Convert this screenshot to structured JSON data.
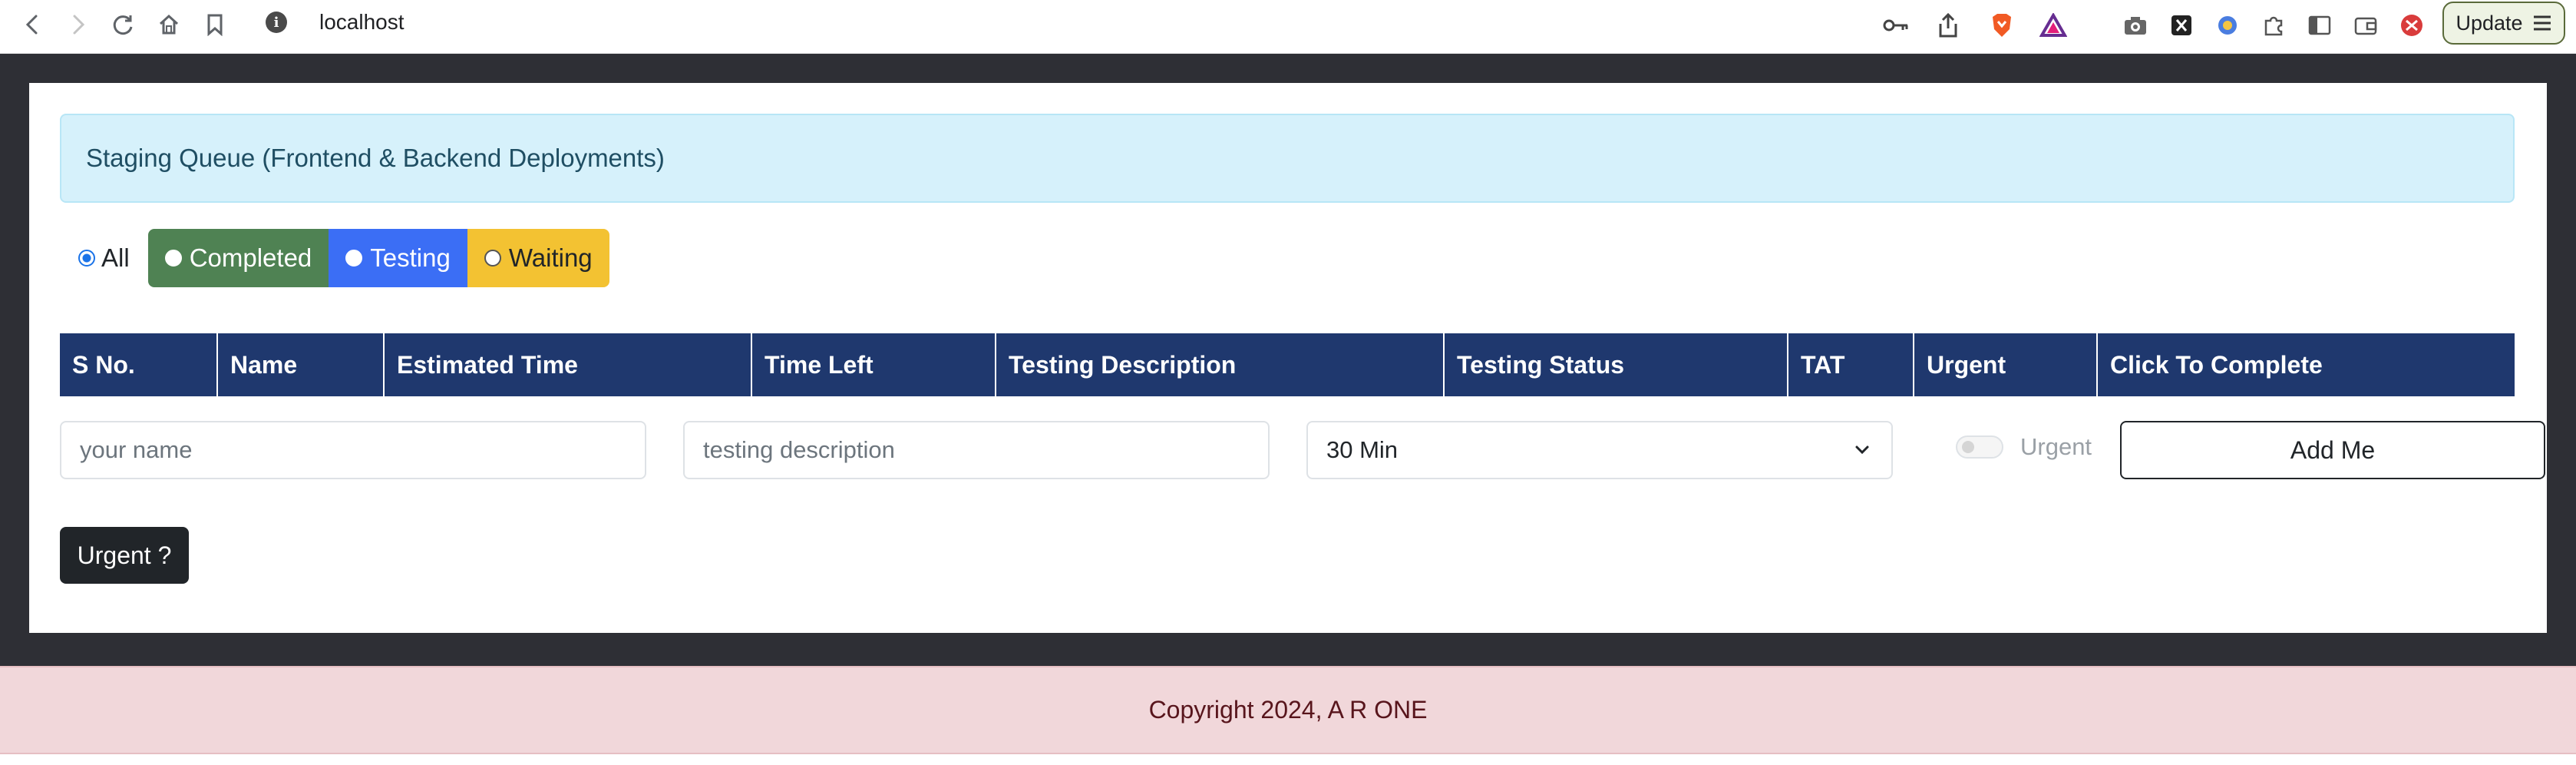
{
  "browser": {
    "url": "localhost",
    "update_label": "Update",
    "icons": [
      "back-icon",
      "forward-icon",
      "reload-icon",
      "home-icon",
      "bookmark-icon",
      "site-info-icon",
      "key-icon",
      "share-icon",
      "brave-shield-icon",
      "brave-rewards-icon",
      "camera-icon",
      "x-extension-icon",
      "extension-icon",
      "puzzle-icon",
      "sidebar-icon",
      "wallet-icon",
      "profile-icon",
      "menu-icon"
    ]
  },
  "alert": {
    "text": "Staging Queue (Frontend & Backend Deployments)"
  },
  "filters": {
    "all": "All",
    "completed": "Completed",
    "testing": "Testing",
    "waiting": "Waiting",
    "selected": "All",
    "colors": {
      "completed": "#4f8253",
      "testing": "#3b6ef5",
      "waiting": "#f3c232"
    }
  },
  "table": {
    "headers": [
      "S No.",
      "Name",
      "Estimated Time",
      "Time Left",
      "Testing Description",
      "Testing Status",
      "TAT",
      "Urgent",
      "Click To Complete"
    ],
    "header_color": "#1f386e"
  },
  "form": {
    "name_placeholder": "your name",
    "description_placeholder": "testing description",
    "time_selected": "30 Min",
    "urgent_label": "Urgent",
    "urgent_checked": false,
    "add_label": "Add Me"
  },
  "urgent_button": "Urgent ?",
  "footer": {
    "text": "Copyright 2024, A R ONE"
  }
}
